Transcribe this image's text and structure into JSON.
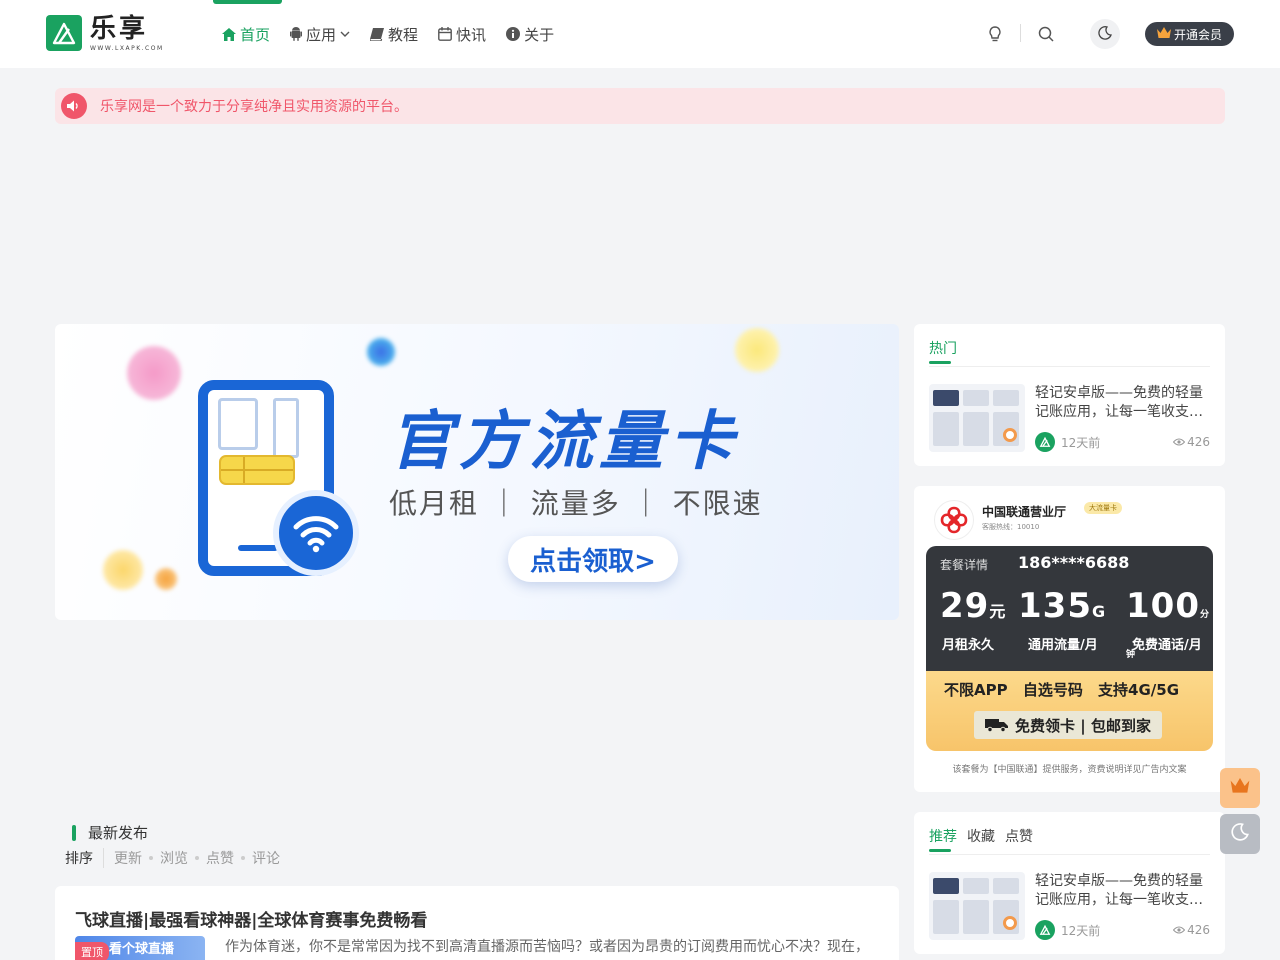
{
  "header": {
    "logo_title": "乐享",
    "logo_sub": "WWW.LXAPK.COM",
    "nav": [
      {
        "label": "首页"
      },
      {
        "label": "应用"
      },
      {
        "label": "教程"
      },
      {
        "label": "快讯"
      },
      {
        "label": "关于"
      }
    ],
    "vip_label": "开通会员"
  },
  "notice": {
    "text": "乐享网是一个致力于分享纯净且实用资源的平台。"
  },
  "banner": {
    "title": "官方流量卡",
    "subtitle": "低月租 ｜ 流量多 ｜ 不限速",
    "cta": "点击领取>"
  },
  "latest": {
    "title": "最新发布",
    "sort_label": "排序",
    "sort_options": [
      "更新",
      "浏览",
      "点赞",
      "评论"
    ]
  },
  "post": {
    "title": "飞球直播|最强看球神器|全球体育赛事免费畅看",
    "tag": "置顶",
    "thumb_text": "看个球直播",
    "excerpt": "作为体育迷，你不是常常因为找不到高清直播源而苦恼吗？或者因为昂贵的订阅费用而忧心不决？现在，"
  },
  "hot": {
    "tab": "热门",
    "item": {
      "title": "轻记安卓版——免费的轻量记账应用，让每一笔收支…",
      "time": "12天前",
      "views": "426"
    }
  },
  "ad": {
    "name": "中国联通营业厅",
    "badge": "大流量卡",
    "hotline": "客服热线：10010",
    "detail_label": "套餐详情",
    "phone": "186****6688",
    "price": "29",
    "price_unit": "元",
    "data": "135",
    "data_unit": "G",
    "minutes": "100",
    "minutes_unit": "分钟",
    "cap1": "月租永久",
    "cap2": "通用流量/月",
    "cap3": "免费通话/月",
    "features": "不限APP 自选号码 支持4G/5G",
    "free": "免费领卡 | 包邮到家",
    "footer": "该套餐为【中国联通】提供服务，资费说明详见广告内文案"
  },
  "recommend": {
    "tabs": [
      "推荐",
      "收藏",
      "点赞"
    ],
    "item": {
      "title": "轻记安卓版——免费的轻量记账应用，让每一笔收支…",
      "time": "12天前",
      "views": "426"
    }
  },
  "colors": {
    "accent": "#1aa260",
    "notice": "#f0566a",
    "banner_blue": "#1a5fd0"
  }
}
